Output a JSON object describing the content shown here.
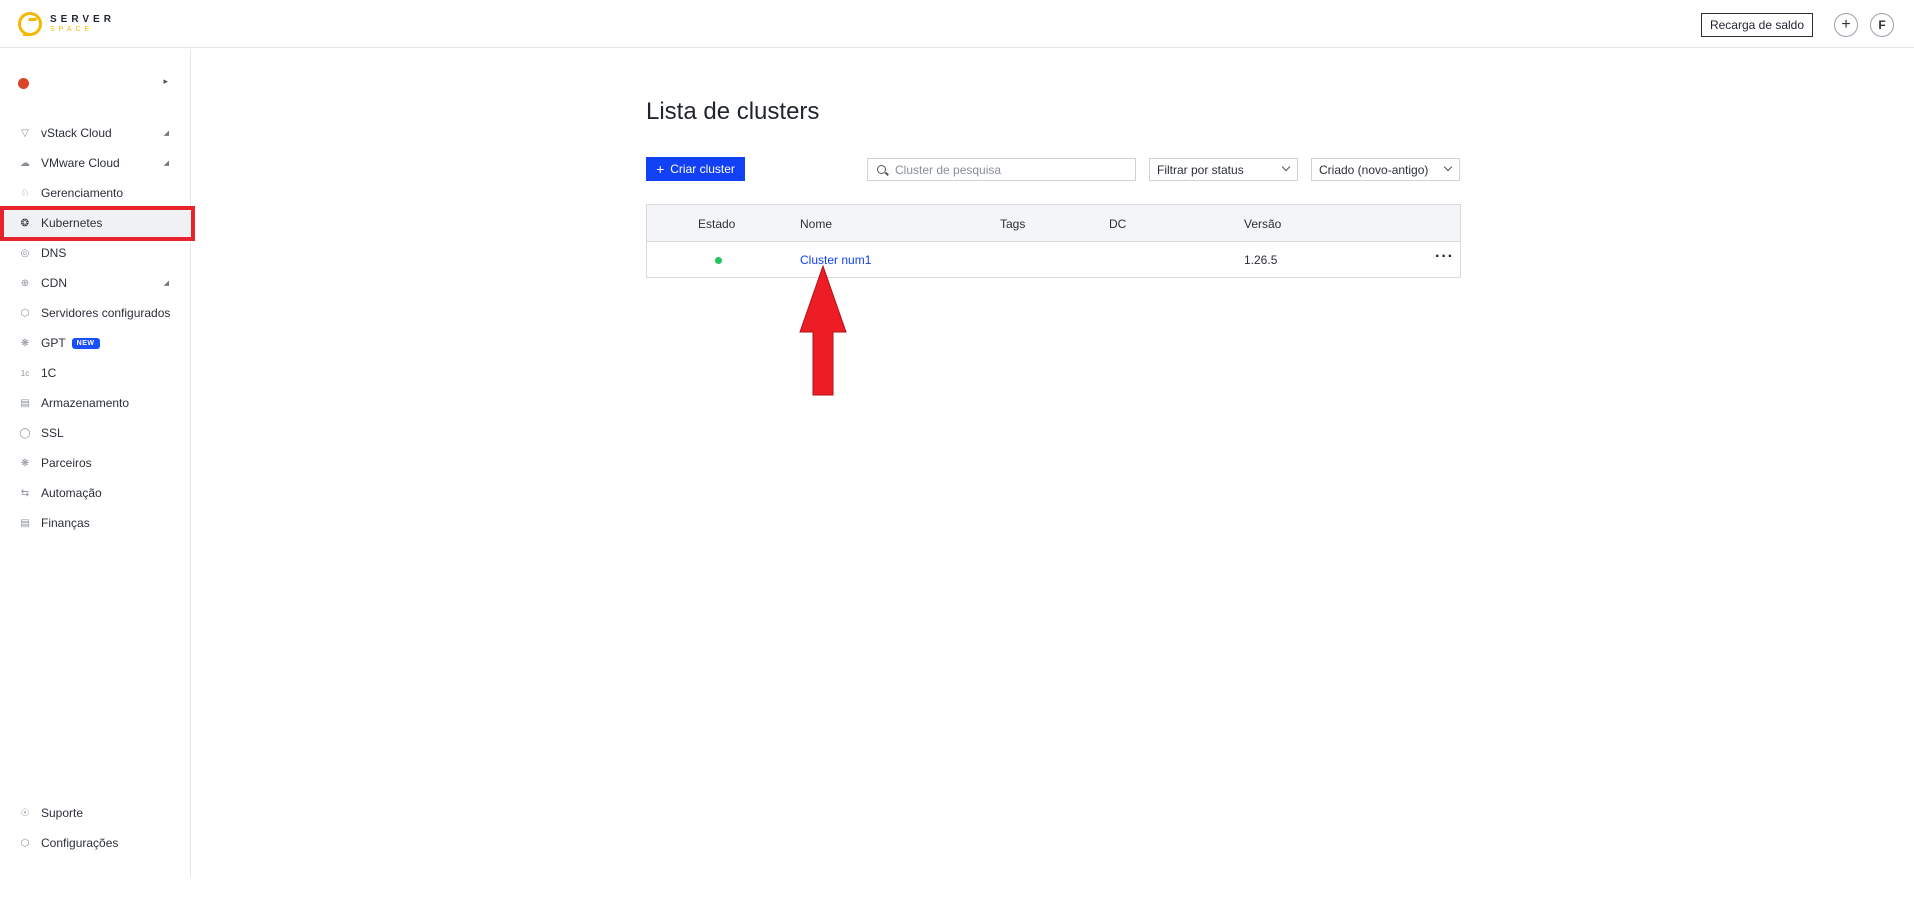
{
  "header": {
    "logo_line1": "SERVER",
    "logo_line2": "SPACE",
    "topup_label": "Recarga de saldo",
    "plus_label": "+",
    "avatar_letter": "F"
  },
  "sidebar": {
    "items": [
      {
        "label": "vStack Cloud",
        "icon": "vstack-icon"
      },
      {
        "label": "VMware Cloud",
        "icon": "cloud-icon"
      },
      {
        "label": "Gerenciamento",
        "icon": "management-icon"
      },
      {
        "label": "Kubernetes",
        "icon": "kubernetes-icon"
      },
      {
        "label": "DNS",
        "icon": "dns-icon"
      },
      {
        "label": "CDN",
        "icon": "globe-icon"
      },
      {
        "label": "Servidores configurados",
        "icon": "hexagon-icon"
      },
      {
        "label": "GPT",
        "icon": "gpt-icon",
        "badge": "NEW"
      },
      {
        "label": "1C",
        "icon": "1c-icon"
      },
      {
        "label": "Armazenamento",
        "icon": "storage-icon"
      },
      {
        "label": "SSL",
        "icon": "shield-icon"
      },
      {
        "label": "Parceiros",
        "icon": "partners-icon"
      },
      {
        "label": "Automação",
        "icon": "automation-icon"
      },
      {
        "label": "Finanças",
        "icon": "document-icon"
      }
    ],
    "bottom": [
      {
        "label": "Suporte",
        "icon": "headset-icon"
      },
      {
        "label": "Configurações",
        "icon": "settings-icon"
      }
    ]
  },
  "main": {
    "title": "Lista de clusters",
    "create_label": "Criar cluster",
    "search_placeholder": "Cluster de pesquisa",
    "status_filter": "Filtrar por status",
    "sort": "Criado (novo-antigo)",
    "table": {
      "headers": [
        "Estado",
        "Nome",
        "Tags",
        "DC",
        "Versão"
      ],
      "rows": [
        {
          "status": "active",
          "status_color": "#22c55e",
          "name": "Cluster num1",
          "tags": "",
          "dc": "",
          "version": "1.26.5"
        }
      ]
    }
  },
  "colors": {
    "accent": "#1240f5",
    "highlight": "#e8232e",
    "brand": "#f5b800"
  }
}
